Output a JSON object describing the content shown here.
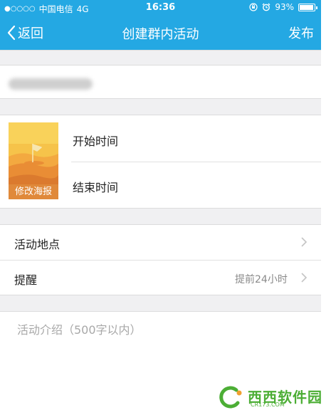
{
  "status_bar": {
    "signal_dots": "●○○○○",
    "carrier": "中国电信",
    "network": "4G",
    "time": "16:36",
    "battery": "93%",
    "battery_level": 0.93,
    "icons": [
      "lock-rotation-icon",
      "alarm-icon",
      "battery-icon"
    ]
  },
  "nav": {
    "back_label": "返回",
    "title": "创建群内活动",
    "publish_label": "发布"
  },
  "form": {
    "poster_label": "修改海报",
    "start_time_label": "开始时间",
    "end_time_label": "结束时间",
    "location_label": "活动地点",
    "reminder_label": "提醒",
    "reminder_value": "提前24小时",
    "intro_placeholder": "活动介绍（500字以内）"
  },
  "watermark": {
    "text": "西西软件园",
    "sub": "CR173.COM"
  },
  "colors": {
    "header": "#24a8e3",
    "page_bg": "#ffffff",
    "section_gap": "#f0f0f2",
    "poster_orange": "#f2a33a",
    "watermark_green": "#4cae35"
  }
}
